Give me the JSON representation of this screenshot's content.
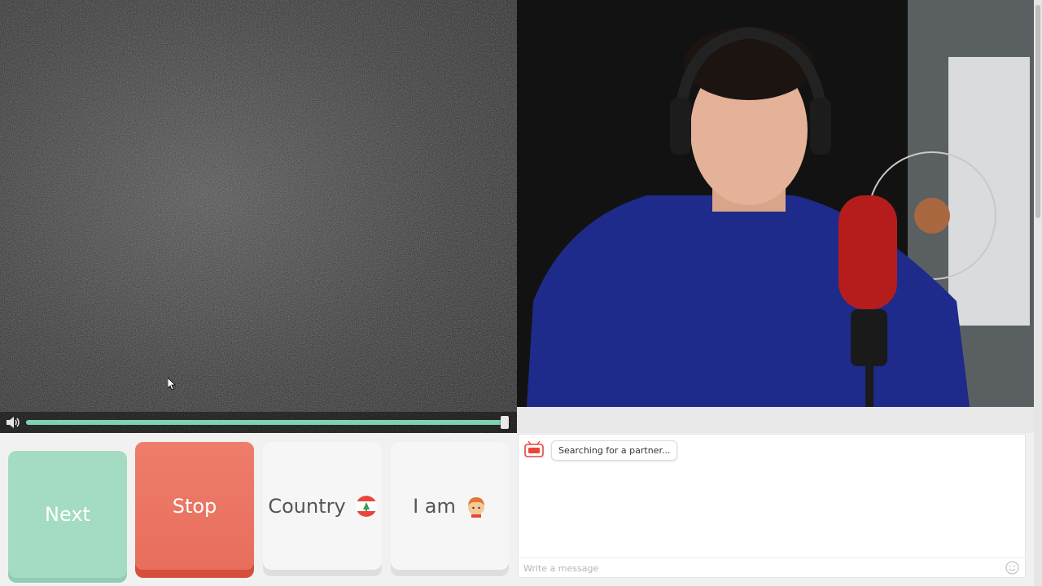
{
  "controls": {
    "next_label": "Next",
    "stop_label": "Stop",
    "country_label": "Country",
    "iam_label": "I am"
  },
  "chat": {
    "status_message": "Searching for a partner...",
    "input_placeholder": "Write a message"
  },
  "volume": {
    "level": 1.0
  },
  "icons": {
    "volume": "speaker-icon",
    "country_flag": "lebanon-flag-icon",
    "gender": "boy-avatar-icon",
    "logo": "ome-tv-logo-icon",
    "emoji": "smiley-icon"
  },
  "colors": {
    "next_bg": "#a3dcc2",
    "stop_bg": "#e86e5c",
    "volume_track": "#7fd2b0"
  }
}
